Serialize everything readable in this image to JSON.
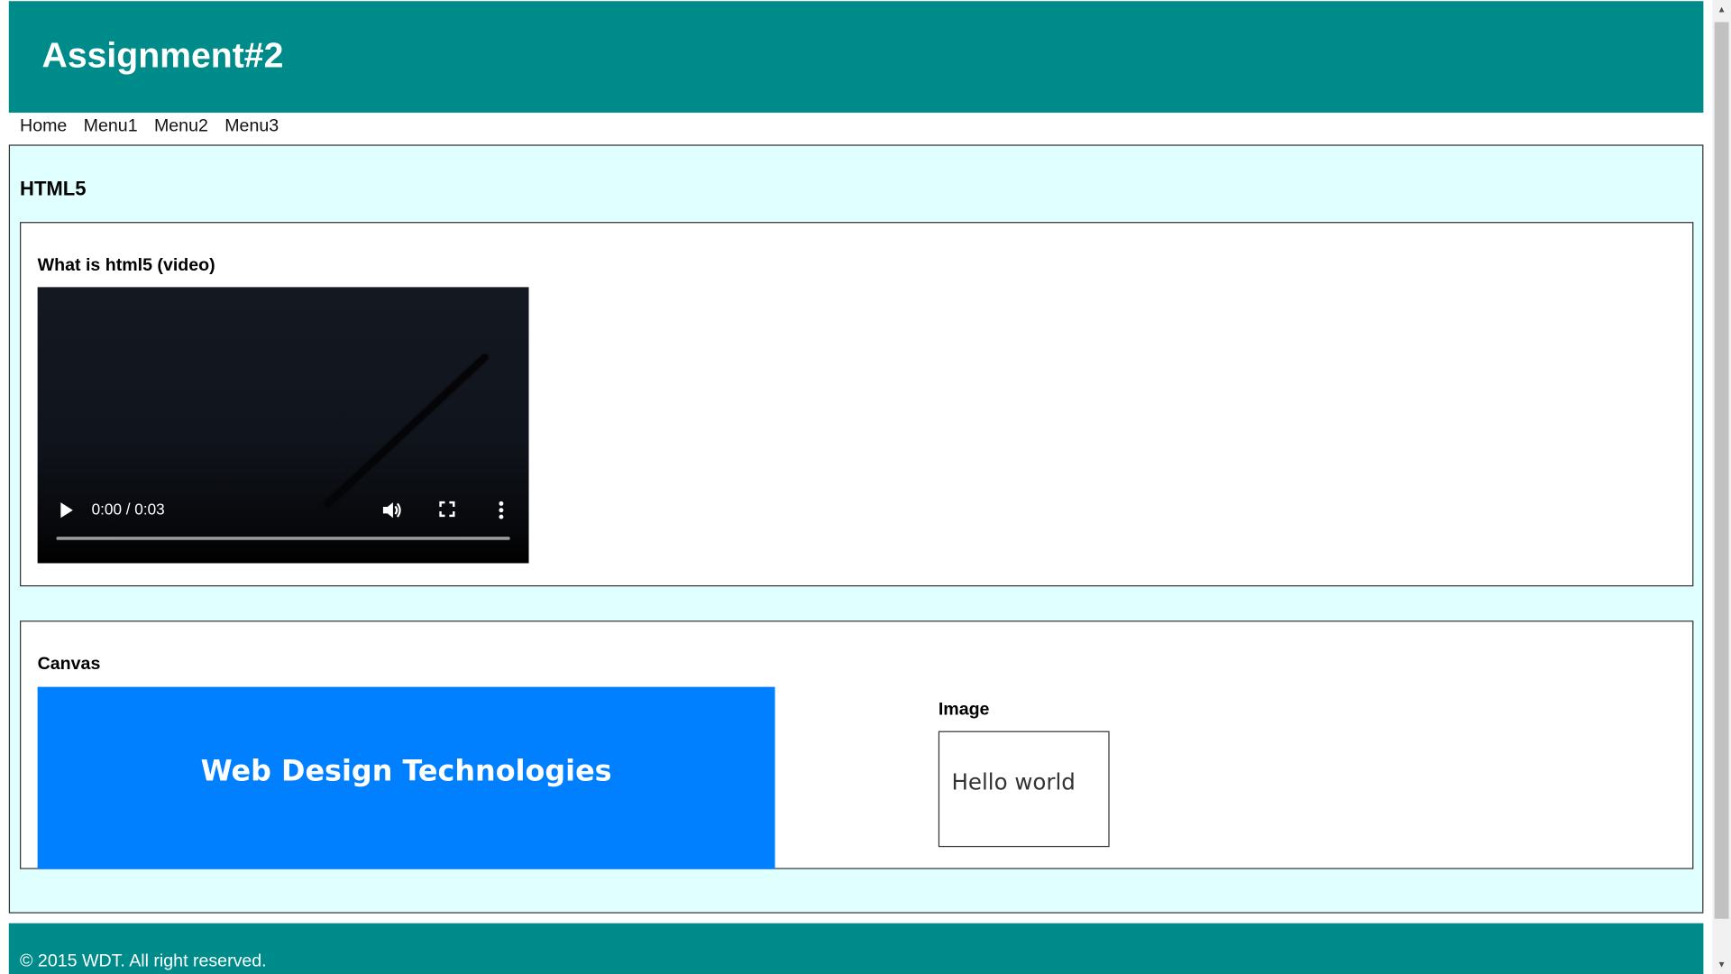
{
  "header": {
    "title": "Assignment#2"
  },
  "nav": {
    "items": [
      {
        "label": "Home"
      },
      {
        "label": "Menu1"
      },
      {
        "label": "Menu2"
      },
      {
        "label": "Menu3"
      }
    ]
  },
  "main": {
    "heading": "HTML5",
    "video_section": {
      "heading": "What is html5 (video)",
      "time": "0:00 / 0:03",
      "progress": 0
    },
    "canvas_section": {
      "heading": "Canvas",
      "canvas_text": "Web Design Technologies",
      "canvas_color": "#0080ff",
      "image_heading": "Image",
      "image_text": "Hello world"
    }
  },
  "footer": {
    "text": "© 2015 WDT. All right reserved."
  },
  "colors": {
    "header_bg": "#008b8b",
    "main_bg": "#e0ffff"
  },
  "icons": {
    "play": "play-icon",
    "volume": "volume-icon",
    "fullscreen": "fullscreen-icon",
    "more": "more-vertical-icon"
  }
}
